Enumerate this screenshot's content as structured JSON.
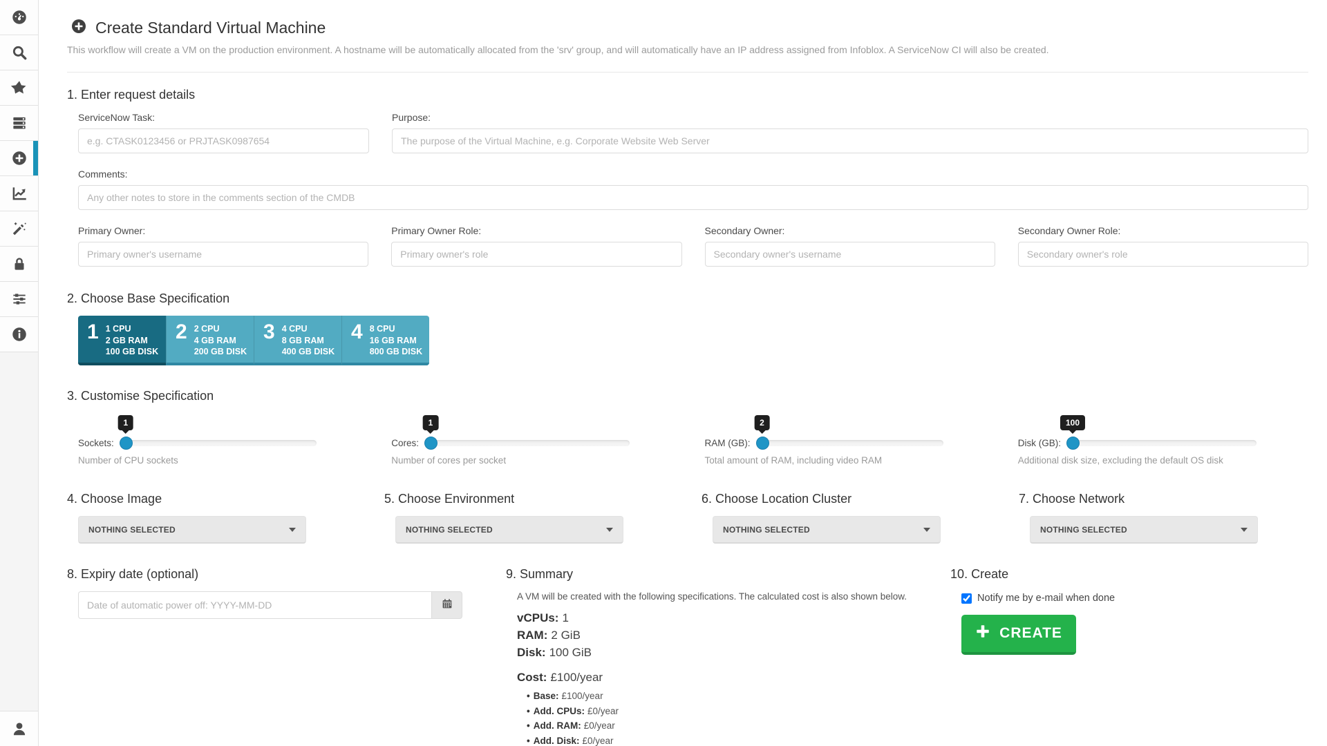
{
  "colors": {
    "accent_blue": "#1a93b8",
    "slider_handle_blue": "#1f95c6",
    "tile_selected_teal": "#186b82",
    "tile_normal_teal": "#52abc2",
    "create_green": "#24b24b",
    "tooltip_black": "#1f1f1f"
  },
  "sidebar": {
    "icons": [
      "dashboard",
      "search",
      "favorites",
      "servers",
      "create",
      "reports",
      "wizard",
      "security",
      "settings",
      "info",
      "user"
    ],
    "active": "create"
  },
  "header": {
    "title": "Create Standard Virtual Machine",
    "subtitle": "This workflow will create a VM on the production environment. A hostname will be automatically allocated from the 'srv' group, and will automatically have an IP address assigned from Infoblox. A ServiceNow CI will also be created."
  },
  "request": {
    "heading": "1. Enter request details",
    "servicenow": {
      "label": "ServiceNow Task:",
      "placeholder": "e.g. CTASK0123456 or PRJTASK0987654"
    },
    "purpose": {
      "label": "Purpose:",
      "placeholder": "The purpose of the Virtual Machine, e.g. Corporate Website Web Server"
    },
    "comments": {
      "label": "Comments:",
      "placeholder": "Any other notes to store in the comments section of the CMDB"
    },
    "owners": [
      {
        "label": "Primary Owner:",
        "placeholder": "Primary owner's username"
      },
      {
        "label": "Primary Owner Role:",
        "placeholder": "Primary owner's role"
      },
      {
        "label": "Secondary Owner:",
        "placeholder": "Secondary owner's username"
      },
      {
        "label": "Secondary Owner Role:",
        "placeholder": "Secondary owner's role"
      }
    ]
  },
  "base_spec": {
    "heading": "2. Choose Base Specification",
    "tiles": [
      {
        "num": "1",
        "cpu": "1 CPU",
        "ram": "2 GB RAM",
        "disk": "100 GB DISK",
        "selected": true
      },
      {
        "num": "2",
        "cpu": "2 CPU",
        "ram": "4 GB RAM",
        "disk": "200 GB DISK",
        "selected": false
      },
      {
        "num": "3",
        "cpu": "4 CPU",
        "ram": "8 GB RAM",
        "disk": "400 GB DISK",
        "selected": false
      },
      {
        "num": "4",
        "cpu": "8 CPU",
        "ram": "16 GB RAM",
        "disk": "800 GB DISK",
        "selected": false
      }
    ]
  },
  "customise": {
    "heading": "3. Customise Specification",
    "sliders": [
      {
        "label": "Sockets:",
        "value": "1",
        "caption": "Number of CPU sockets"
      },
      {
        "label": "Cores:",
        "value": "1",
        "caption": "Number of cores per socket"
      },
      {
        "label": "RAM (GB):",
        "value": "2",
        "caption": "Total amount of RAM, including video RAM"
      },
      {
        "label": "Disk (GB):",
        "value": "100",
        "caption": "Additional disk size, excluding the default OS disk"
      }
    ]
  },
  "choosers": [
    {
      "heading": "4. Choose Image",
      "value": "NOTHING SELECTED"
    },
    {
      "heading": "5. Choose Environment",
      "value": "NOTHING SELECTED"
    },
    {
      "heading": "6. Choose Location Cluster",
      "value": "NOTHING SELECTED"
    },
    {
      "heading": "7. Choose Network",
      "value": "NOTHING SELECTED"
    }
  ],
  "expiry": {
    "heading": "8. Expiry date (optional)",
    "placeholder": "Date of automatic power off: YYYY-MM-DD"
  },
  "summary": {
    "heading": "9. Summary",
    "intro": "A VM will be created with the following specifications. The calculated cost is also shown below.",
    "specs": [
      {
        "label": "vCPUs:",
        "value": "1"
      },
      {
        "label": "RAM:",
        "value": "2 GiB"
      },
      {
        "label": "Disk:",
        "value": "100 GiB"
      }
    ],
    "cost": {
      "label": "Cost:",
      "value": "£100/year"
    },
    "breakdown": [
      {
        "label": "Base:",
        "value": "£100/year"
      },
      {
        "label": "Add. CPUs:",
        "value": "£0/year"
      },
      {
        "label": "Add. RAM:",
        "value": "£0/year"
      },
      {
        "label": "Add. Disk:",
        "value": "£0/year"
      }
    ]
  },
  "create": {
    "heading": "10. Create",
    "notify_label": "Notify me by e-mail when done",
    "notify_checked": "checked",
    "button_label": "CREATE"
  }
}
